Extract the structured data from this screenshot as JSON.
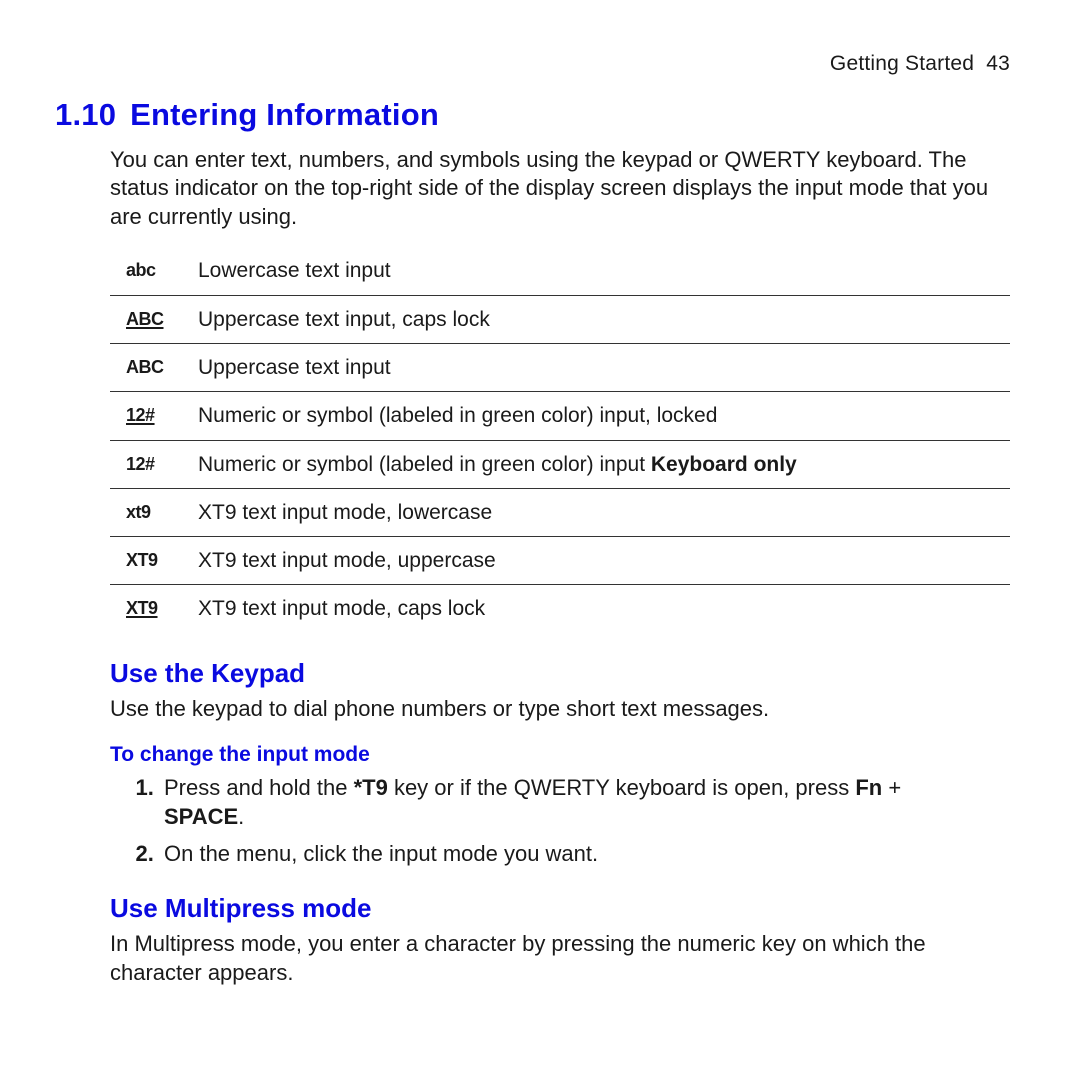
{
  "header": {
    "chapter": "Getting Started",
    "page": "43"
  },
  "section": {
    "number": "1.10",
    "title": "Entering Information",
    "intro": "You can enter text, numbers, and symbols using the keypad or QWERTY keyboard. The status indicator on the top-right side of the display screen displays the input mode that you are currently using."
  },
  "indicators": [
    {
      "icon": "abc",
      "underline": false,
      "desc_pre": "Lowercase text input",
      "desc_bold": "",
      "desc_post": ""
    },
    {
      "icon": "ABC",
      "underline": true,
      "desc_pre": "Uppercase text input, caps lock",
      "desc_bold": "",
      "desc_post": ""
    },
    {
      "icon": "ABC",
      "underline": false,
      "desc_pre": "Uppercase text input",
      "desc_bold": "",
      "desc_post": ""
    },
    {
      "icon": "12#",
      "underline": true,
      "desc_pre": "Numeric or symbol (labeled in green color) input, locked",
      "desc_bold": "",
      "desc_post": ""
    },
    {
      "icon": "12#",
      "underline": false,
      "desc_pre": "Numeric or symbol (labeled in green color) input ",
      "desc_bold": "Keyboard only",
      "desc_post": ""
    },
    {
      "icon": "xt9",
      "underline": false,
      "desc_pre": "XT9 text input mode, lowercase",
      "desc_bold": "",
      "desc_post": ""
    },
    {
      "icon": "XT9",
      "underline": false,
      "desc_pre": "XT9 text input mode, uppercase",
      "desc_bold": "",
      "desc_post": ""
    },
    {
      "icon": "XT9",
      "underline": true,
      "desc_pre": "XT9 text input mode, caps lock",
      "desc_bold": "",
      "desc_post": ""
    }
  ],
  "keypad": {
    "heading": "Use the Keypad",
    "body": "Use the keypad to dial phone numbers or type short text messages.",
    "change_heading": "To change the input mode",
    "step1_pre": "Press and hold the ",
    "step1_b1": "*T9",
    "step1_mid": " key or if the QWERTY keyboard is open, press ",
    "step1_b2": "Fn",
    "step1_post": " + ",
    "step1_b3": "SPACE",
    "step1_end": ".",
    "step2": "On the menu, click the input mode you want."
  },
  "multipress": {
    "heading": "Use Multipress mode",
    "body": "In Multipress mode, you enter a character by pressing the numeric key on which the character appears."
  }
}
